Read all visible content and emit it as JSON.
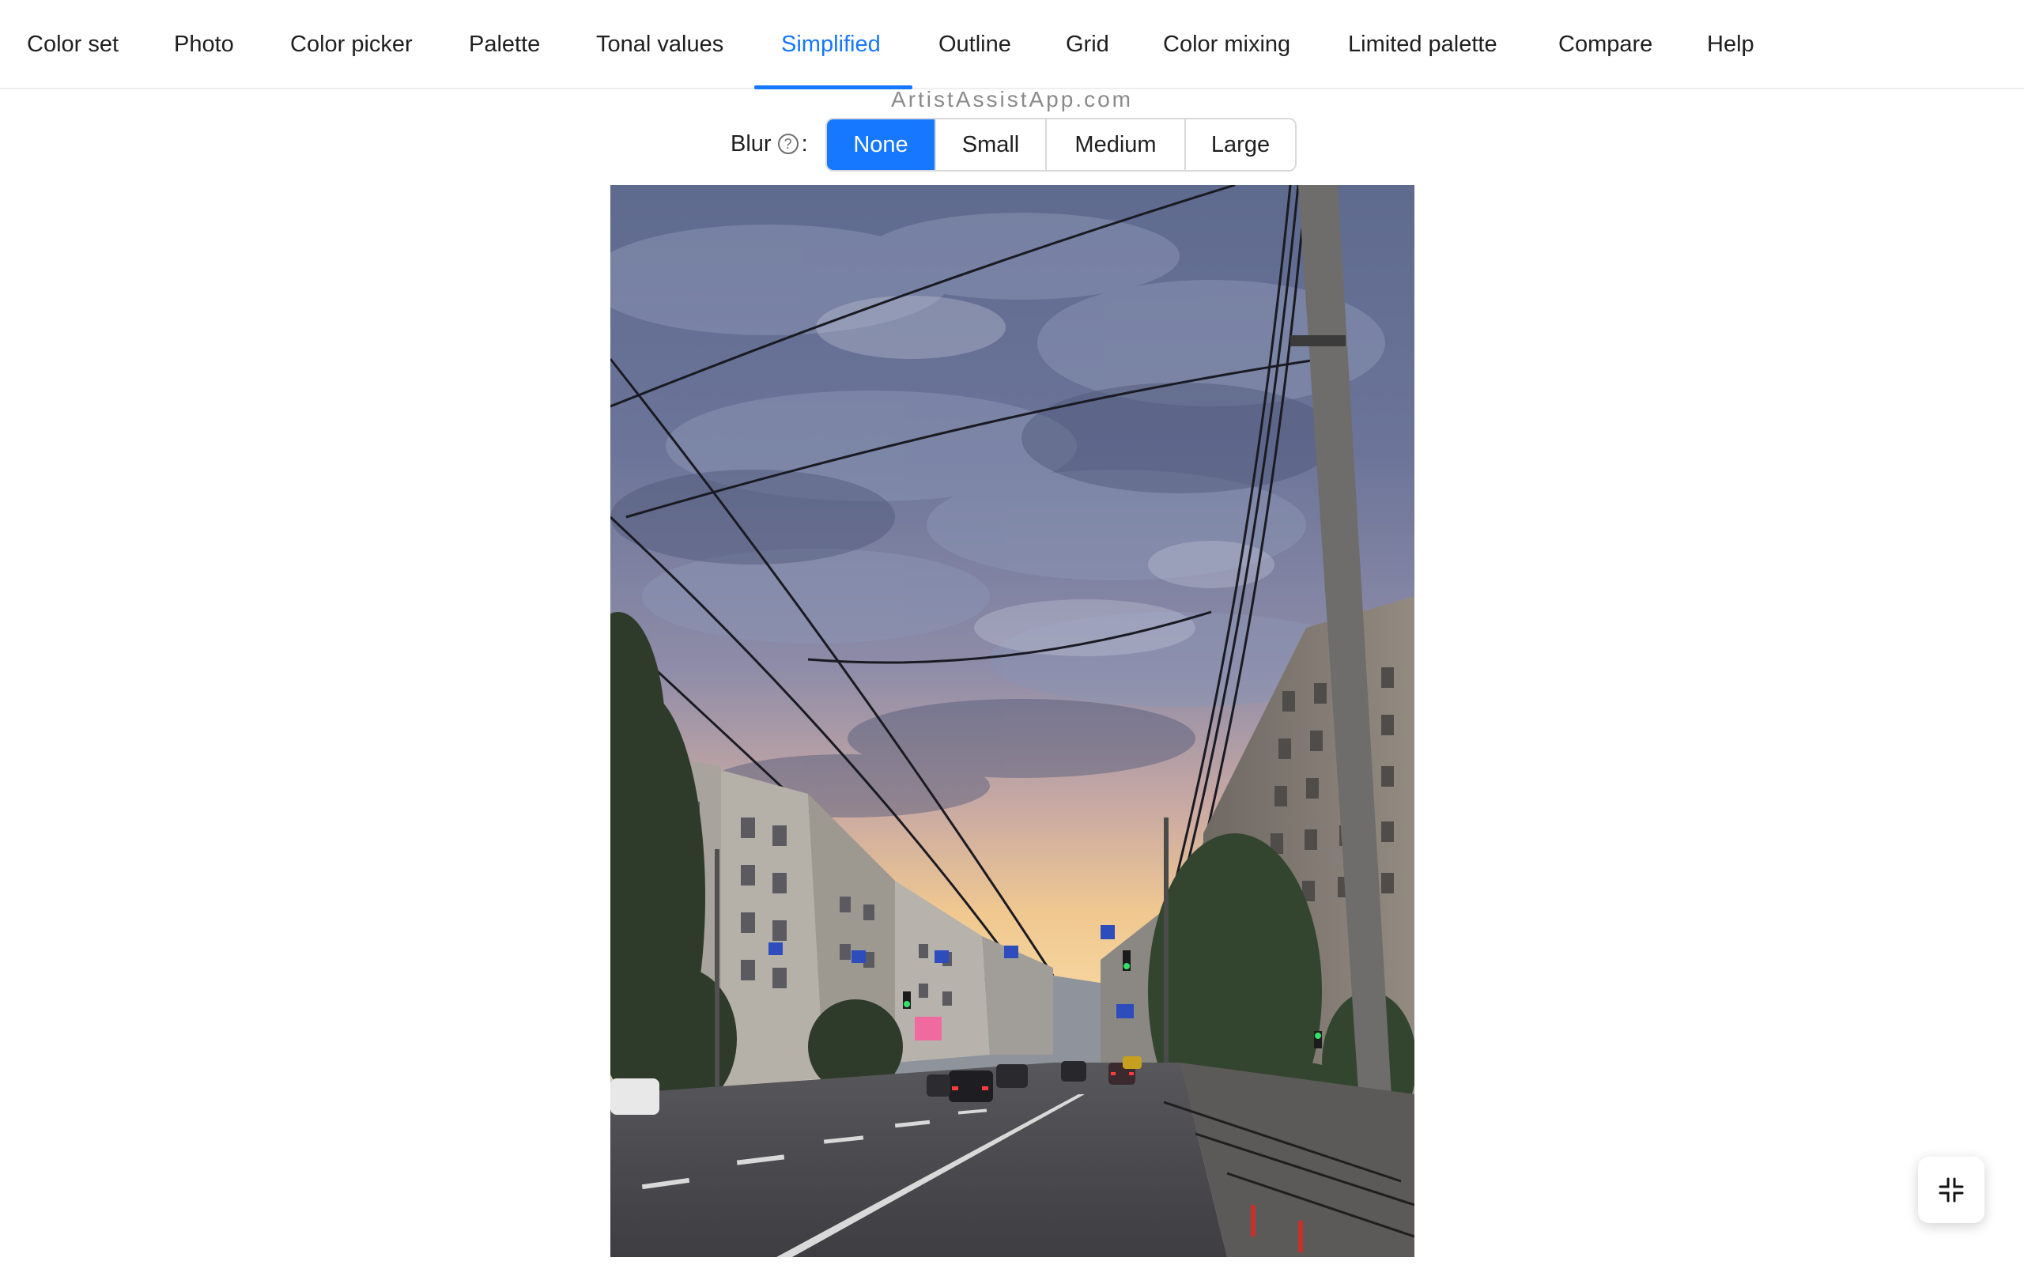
{
  "tabs": [
    {
      "label": "Color set"
    },
    {
      "label": "Photo"
    },
    {
      "label": "Color picker"
    },
    {
      "label": "Palette"
    },
    {
      "label": "Tonal values"
    },
    {
      "label": "Simplified",
      "active": true
    },
    {
      "label": "Outline"
    },
    {
      "label": "Grid"
    },
    {
      "label": "Color mixing"
    },
    {
      "label": "Limited palette"
    },
    {
      "label": "Compare"
    },
    {
      "label": "Help"
    }
  ],
  "watermark": "ArtistAssistApp.com",
  "blur": {
    "label": "Blur",
    "help_icon": "question-circle-icon",
    "colon": ":",
    "options": [
      "None",
      "Small",
      "Medium",
      "Large"
    ],
    "selected": "None"
  },
  "fullscreen_button_icon": "fullscreen-exit-icon",
  "colors": {
    "accent": "#1677ff",
    "text": "#1f1f1f",
    "watermark": "#8a8a8a"
  }
}
